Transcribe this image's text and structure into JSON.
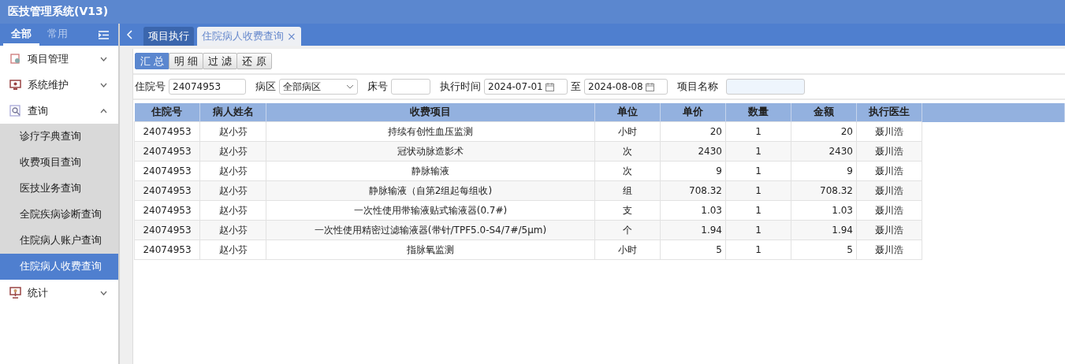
{
  "window": {
    "title": "医技管理系统(V13)"
  },
  "sidebar": {
    "tabs": [
      {
        "label": "全部",
        "selected": true
      },
      {
        "label": "常用",
        "selected": false
      }
    ],
    "items": [
      {
        "label": "项目管理",
        "expanded": false,
        "selected": false
      },
      {
        "label": "系统维护",
        "expanded": false,
        "selected": false
      },
      {
        "label": "查询",
        "expanded": true,
        "selected": false,
        "children": [
          {
            "label": "诊疗字典查询",
            "selected": false
          },
          {
            "label": "收费项目查询",
            "selected": false
          },
          {
            "label": "医技业务查询",
            "selected": false
          },
          {
            "label": "全院疾病诊断查询",
            "selected": false
          },
          {
            "label": "住院病人账户查询",
            "selected": false
          },
          {
            "label": "住院病人收费查询",
            "selected": true
          }
        ]
      },
      {
        "label": "统计",
        "expanded": false,
        "selected": false
      }
    ]
  },
  "tabs": [
    {
      "label": "项目执行",
      "selected": false,
      "closable": false
    },
    {
      "label": "住院病人收费查询",
      "selected": true,
      "closable": true
    }
  ],
  "tab_close_glyph": "×",
  "toolbar": [
    {
      "label": "汇 总",
      "selected": true
    },
    {
      "label": "明 细",
      "selected": false
    },
    {
      "label": "过 滤",
      "selected": false
    },
    {
      "label": "还 原",
      "selected": false
    }
  ],
  "filters": {
    "admission_label": "住院号",
    "admission_value": "24074953",
    "ward_label": "病区",
    "ward_value": "全部病区",
    "bed_label": "床号",
    "time_label": "执行时间",
    "date_from": "2024-07-01",
    "to_label": "至",
    "date_to": "2024-08-08",
    "item_label": "项目名称"
  },
  "table": {
    "columns": [
      "住院号",
      "病人姓名",
      "收费项目",
      "单位",
      "单价",
      "数量",
      "金额",
      "执行医生"
    ],
    "rows": [
      [
        "24074953",
        "赵小芬",
        "持续有创性血压监测",
        "小时",
        "20",
        "1",
        "20",
        "聂川浩"
      ],
      [
        "24074953",
        "赵小芬",
        "冠状动脉造影术",
        "次",
        "2430",
        "1",
        "2430",
        "聂川浩"
      ],
      [
        "24074953",
        "赵小芬",
        "静脉输液",
        "次",
        "9",
        "1",
        "9",
        "聂川浩"
      ],
      [
        "24074953",
        "赵小芬",
        "静脉输液（自第2组起每组收)",
        "组",
        "708.32",
        "1",
        "708.32",
        "聂川浩"
      ],
      [
        "24074953",
        "赵小芬",
        "一次性使用带输液贴式输液器(0.7#)",
        "支",
        "1.03",
        "1",
        "1.03",
        "聂川浩"
      ],
      [
        "24074953",
        "赵小芬",
        "一次性使用精密过滤输液器(带针/TPF5.0-S4/7#/5μm)",
        "个",
        "1.94",
        "1",
        "1.94",
        "聂川浩"
      ],
      [
        "24074953",
        "赵小芬",
        "指脉氧监测",
        "小时",
        "5",
        "1",
        "5",
        "聂川浩"
      ]
    ]
  }
}
